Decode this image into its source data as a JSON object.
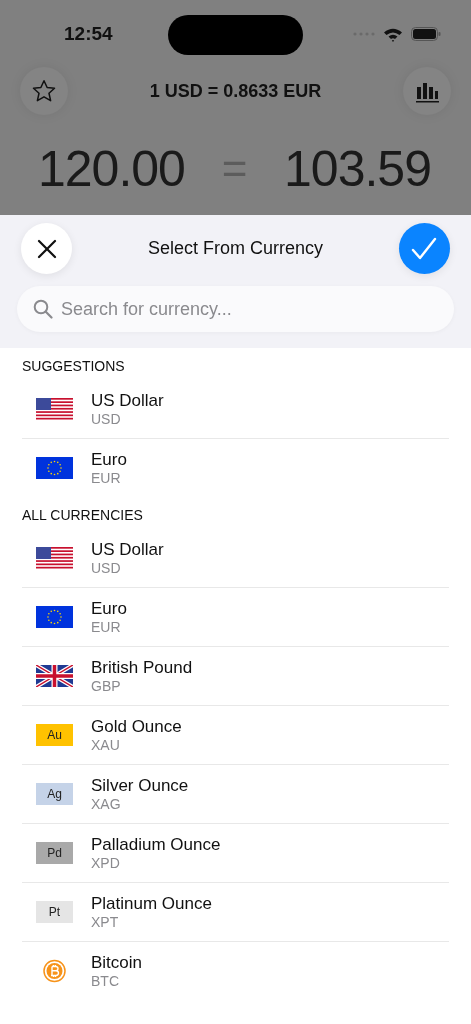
{
  "status_bar": {
    "time": "12:54"
  },
  "rate_bar": {
    "rate": "1 USD = 0.8633 EUR"
  },
  "amounts": {
    "from": "120.00",
    "equals": "=",
    "to": "103.59"
  },
  "sheet": {
    "title": "Select From Currency",
    "search": {
      "placeholder": "Search for currency..."
    }
  },
  "sections": [
    {
      "title": "SUGGESTIONS",
      "items": [
        {
          "name": "US Dollar",
          "code": "USD",
          "kind": "flag-us"
        },
        {
          "name": "Euro",
          "code": "EUR",
          "kind": "flag-eu"
        }
      ]
    },
    {
      "title": "ALL CURRENCIES",
      "items": [
        {
          "name": "US Dollar",
          "code": "USD",
          "kind": "flag-us"
        },
        {
          "name": "Euro",
          "code": "EUR",
          "kind": "flag-eu"
        },
        {
          "name": "British Pound",
          "code": "GBP",
          "kind": "flag-gb"
        },
        {
          "name": "Gold Ounce",
          "code": "XAU",
          "kind": "metal",
          "symbol": "Au",
          "color": "#ffc200"
        },
        {
          "name": "Silver Ounce",
          "code": "XAG",
          "kind": "metal",
          "symbol": "Ag",
          "color": "#c5d3e8"
        },
        {
          "name": "Palladium Ounce",
          "code": "XPD",
          "kind": "metal",
          "symbol": "Pd",
          "color": "#a9a9a9"
        },
        {
          "name": "Platinum Ounce",
          "code": "XPT",
          "kind": "metal",
          "symbol": "Pt",
          "color": "#e5e5e5"
        },
        {
          "name": "Bitcoin",
          "code": "BTC",
          "kind": "bitcoin"
        }
      ]
    }
  ]
}
